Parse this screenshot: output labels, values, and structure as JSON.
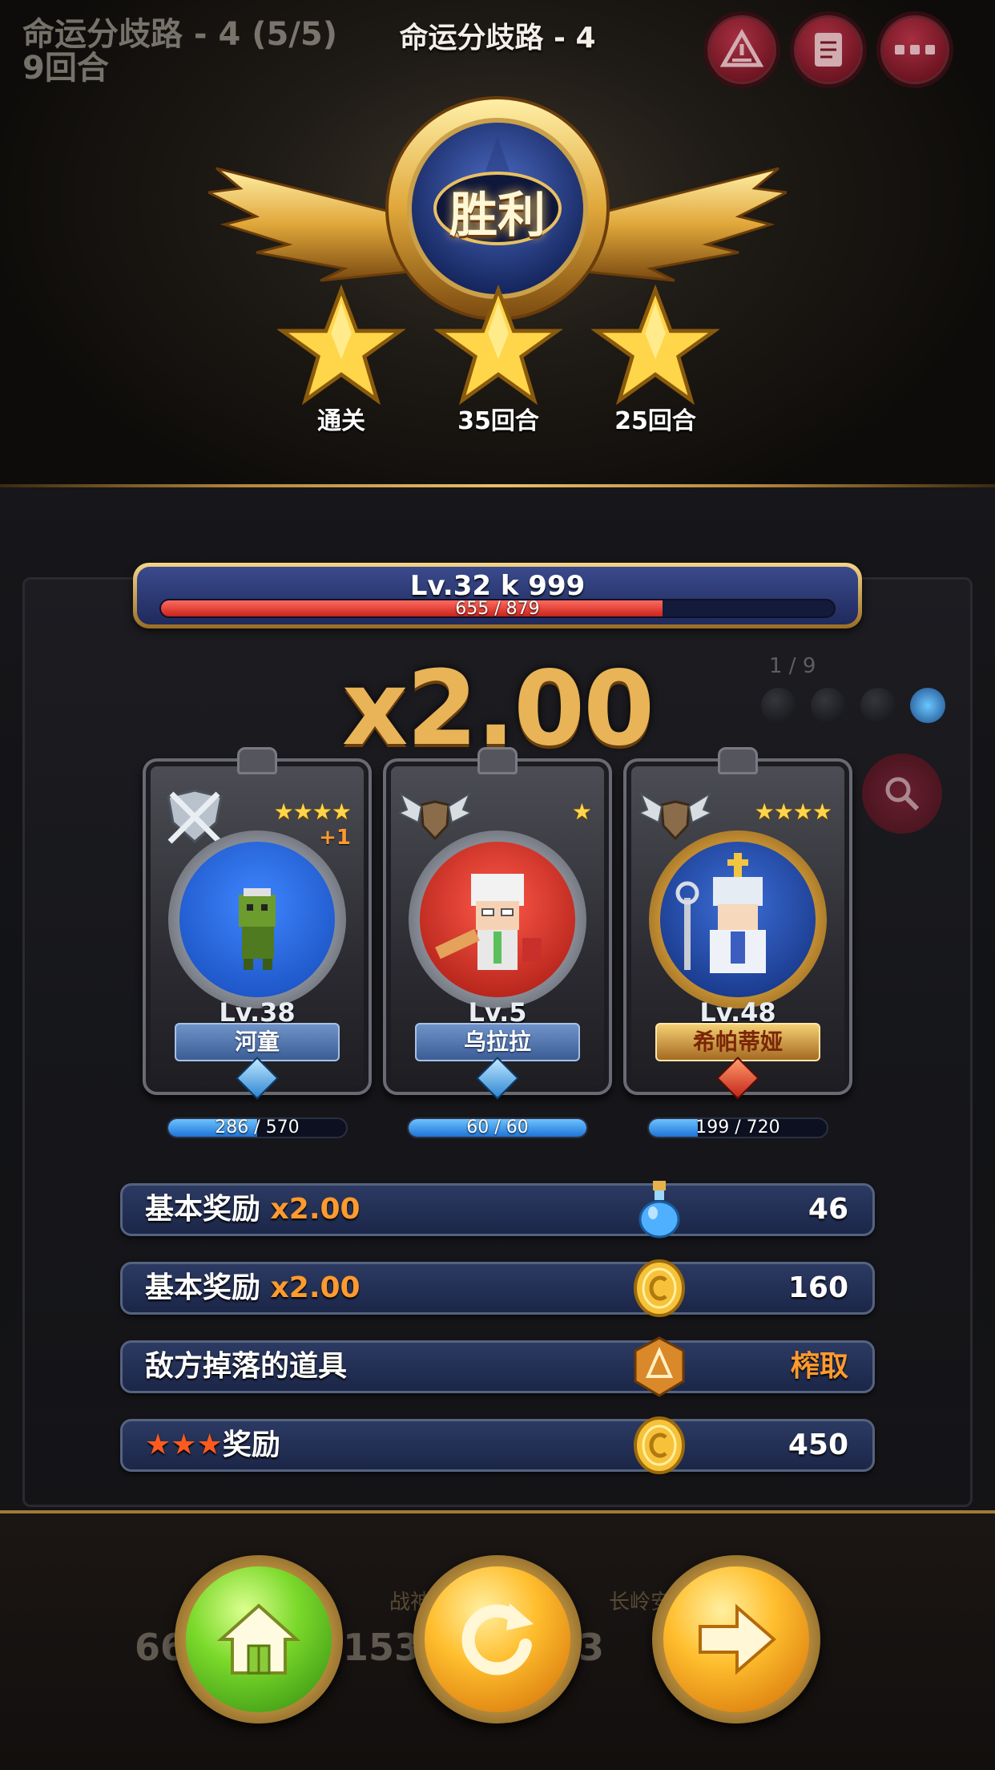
{
  "hud": {
    "stage_progress": "命运分歧路 - 4 (5/5)",
    "turns": "9回合",
    "stage_title": "命运分歧路 - 4",
    "buttons": [
      "alert-icon",
      "scroll-icon",
      "more-icon"
    ]
  },
  "victory": {
    "title": "胜利",
    "stars": [
      {
        "label": "通关",
        "earned": true
      },
      {
        "label": "35回合",
        "earned": true
      },
      {
        "label": "25回合",
        "earned": true
      }
    ]
  },
  "player": {
    "level_text": "Lv.32  k 999",
    "xp_text": "655 / 879",
    "xp_current": 655,
    "xp_max": 879
  },
  "multiplier": "x2.00",
  "background": {
    "counter": "1 / 9",
    "dim_counts": [
      "66",
      "153",
      "3"
    ],
    "dim_names": [
      "战神",
      "长岭安"
    ]
  },
  "heroes": [
    {
      "stars": "★★★★",
      "plus": "+1",
      "level": "Lv.38",
      "name": "河童",
      "xp_text": "286 / 570",
      "xp_current": 286,
      "xp_max": 570,
      "class": "crossed-swords-shield-icon",
      "ribbon": "blue"
    },
    {
      "stars": "★",
      "plus": "",
      "level": "Lv.5",
      "name": "乌拉拉",
      "xp_text": "60 / 60",
      "xp_current": 60,
      "xp_max": 60,
      "class": "winged-shield-icon",
      "ribbon": "blue"
    },
    {
      "stars": "★★★★",
      "plus": "",
      "level": "Lv.48",
      "name": "希帕蒂娅",
      "xp_text": "199 / 720",
      "xp_current": 199,
      "xp_max": 720,
      "class": "winged-shield-icon",
      "ribbon": "gold"
    }
  ],
  "rewards": [
    {
      "label": "基本奖励 ",
      "mult": "x2.00",
      "icon": "potion-icon",
      "value": "46"
    },
    {
      "label": "基本奖励 ",
      "mult": "x2.00",
      "icon": "gold-coin-icon",
      "value": "160"
    },
    {
      "label": "敌方掉落的道具",
      "mult": "",
      "icon": "bronze-medal-icon",
      "value": "榨取"
    },
    {
      "stars": "★★★",
      "label": "奖励",
      "icon": "gold-coin-icon",
      "value": "450"
    }
  ],
  "actions": {
    "home": "home-icon",
    "retry": "retry-icon",
    "next": "next-arrow-icon"
  },
  "colors": {
    "accent_gold": "#e8b457",
    "reward_orange": "#ff9a2e",
    "xp_red": "#c8231b",
    "xp_blue": "#1f74d6"
  }
}
